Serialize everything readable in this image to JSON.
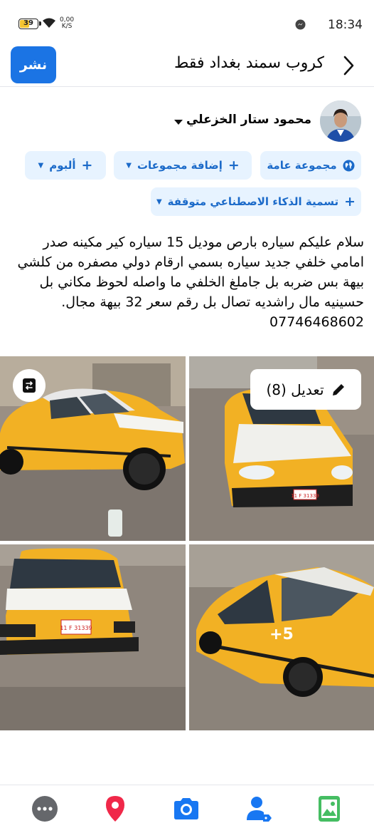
{
  "status_bar": {
    "battery": "39",
    "net_speed_value": "0,00",
    "net_speed_unit": "K/S",
    "time": "18:34"
  },
  "header": {
    "title": "كروب سمند بغداد  فقط",
    "publish_label": "نشر"
  },
  "author": {
    "name": "محمود ستار الخزعلي"
  },
  "pills": {
    "audience": "مجموعة عامة",
    "add_groups": "إضافة مجموعات",
    "album": "ألبوم",
    "ai_label": "تسمية الذكاء الاصطناعي متوقفة"
  },
  "post": {
    "text": "سلام عليكم سياره بارص موديل 15 سياره كير مكينه صدر امامي خلفي جديد سياره بسمي ارقام دولي مصفره من كلشي بيهة بس ضربه بل جاملغ الخلفي ما واصله لحوظ مكاني بل حسينيه مال راشديه تصال بل رقم سعر 32 بيهة مجال.  07746468602"
  },
  "photos": {
    "edit_label": "تعديل (8)",
    "more_count": "+5",
    "plate_front": "11 F 31339",
    "plate_rear": "11 F 31339"
  },
  "bottom_nav": {
    "items": [
      "more",
      "location",
      "camera",
      "tag-people",
      "photo"
    ]
  },
  "colors": {
    "accent": "#1b74e4",
    "pill_bg": "#e7f3ff",
    "location": "#f02849",
    "tag": "#1877f2",
    "photo": "#45bd62"
  }
}
